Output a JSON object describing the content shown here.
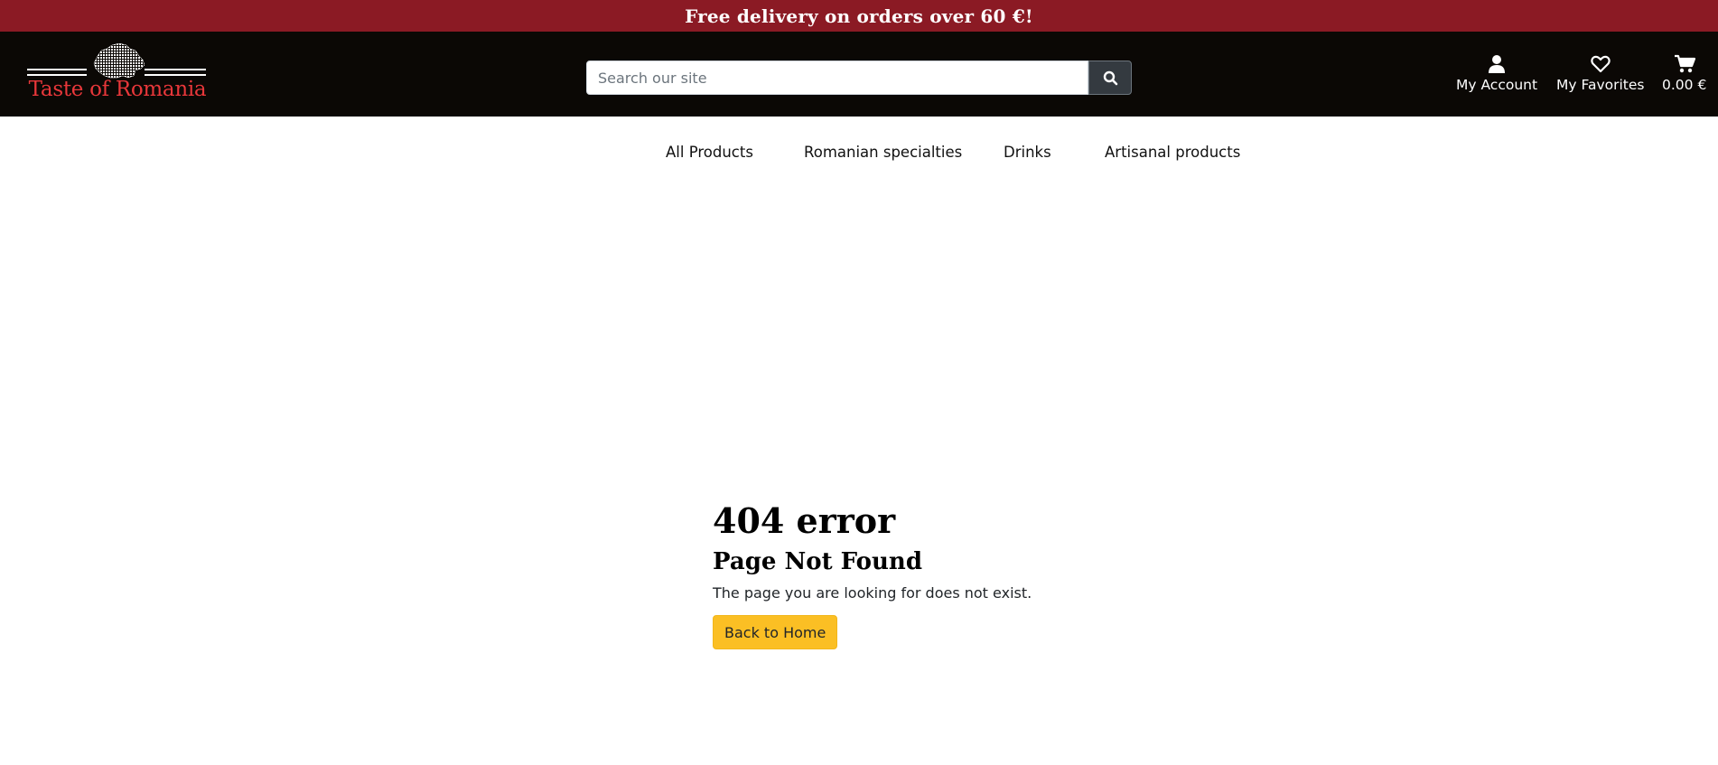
{
  "promo": {
    "text": "Free delivery on orders over 60 €!"
  },
  "header": {
    "logo_text": "Taste of Romania",
    "search": {
      "placeholder": "Search our site",
      "value": ""
    },
    "actions": {
      "account_label": "My Account",
      "favorites_label": "My Favorites",
      "cart_total": "0.00 €"
    },
    "icons": {
      "search": "search-icon",
      "account": "user-icon",
      "favorites": "heart-icon",
      "cart": "cart-icon"
    }
  },
  "nav": {
    "items": [
      {
        "label": "All Products"
      },
      {
        "label": "Romanian specialties"
      },
      {
        "label": "Drinks"
      },
      {
        "label": "Artisanal products"
      }
    ]
  },
  "error": {
    "title": "404 error",
    "subtitle": "Page Not Found",
    "message": "The page you are looking for does not exist.",
    "button_label": "Back to Home"
  },
  "colors": {
    "promo_bg": "#8b1a24",
    "header_bg": "#0b0805",
    "logo_text": "#e8373a",
    "search_button_bg": "#343a40",
    "home_button_bg": "#fbbf24"
  }
}
